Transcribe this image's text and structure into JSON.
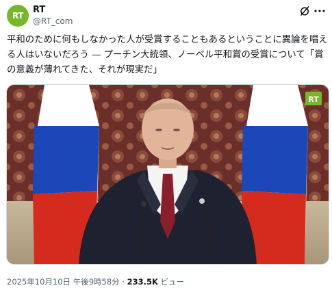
{
  "account": {
    "name": "RT",
    "handle": "@RT_com",
    "avatar_text": "RT",
    "avatar_color": "#76b82a"
  },
  "header_icons": [
    "grok-icon",
    "more-icon"
  ],
  "tweet": {
    "text": "平和のために何もしなかった人が受賞することもあるということに異論を唱える人はいないだろう — プーチン大統領、ノーベル平和賞の受賞について「賞の意義が薄れてきた、それが現実だ」"
  },
  "media": {
    "watermark": "RT",
    "flag_colors": [
      "#ffffff",
      "#1c47b8",
      "#d52b1e"
    ]
  },
  "meta": {
    "date": "2025年10月10日 午後9時58分",
    "separator": " · ",
    "views_count": "233.5K",
    "views_label": " ビュー"
  }
}
